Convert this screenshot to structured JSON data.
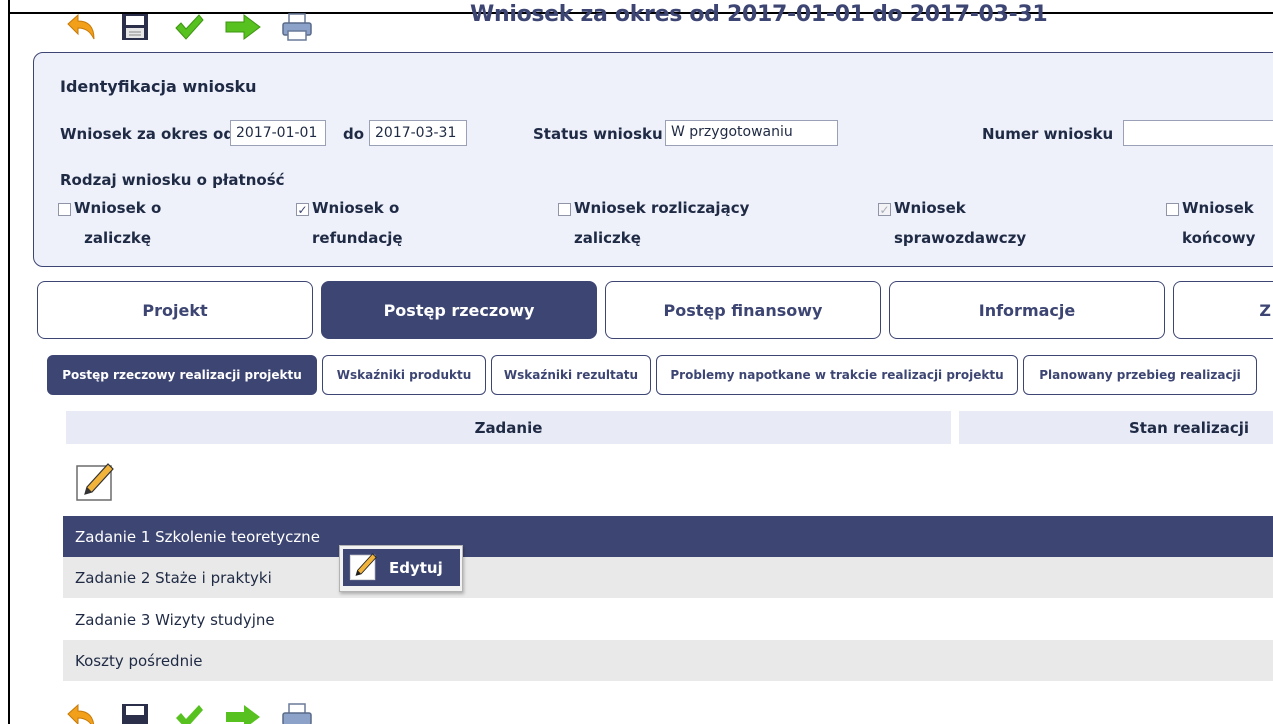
{
  "page_title": "Wniosek za okres od 2017-01-01 do 2017-03-31",
  "toolbar": {
    "icons": [
      "undo-icon",
      "save-icon",
      "check-icon",
      "send-icon",
      "print-icon"
    ]
  },
  "identification": {
    "title": "Identyfikacja wniosku",
    "period_from_label": "Wniosek za okres od",
    "period_from_value": "2017-01-01",
    "period_to_label": "do",
    "period_to_value": "2017-03-31",
    "status_label": "Status wniosku",
    "status_value": "W przygotowaniu",
    "number_label": "Numer wniosku",
    "number_value": "",
    "type_label": "Rodzaj wniosku o płatność",
    "types": [
      {
        "line1": "Wniosek o",
        "line2": "zaliczkę",
        "checked": false,
        "disabled": false
      },
      {
        "line1": "Wniosek o",
        "line2": "refundację",
        "checked": true,
        "disabled": false
      },
      {
        "line1": "Wniosek rozliczający",
        "line2": "zaliczkę",
        "checked": false,
        "disabled": false
      },
      {
        "line1": "Wniosek",
        "line2": "sprawozdawczy",
        "checked": true,
        "disabled": true
      },
      {
        "line1": "Wniosek",
        "line2": "końcowy",
        "checked": false,
        "disabled": false
      }
    ]
  },
  "tabs": [
    {
      "label": "Projekt",
      "active": false
    },
    {
      "label": "Postęp rzeczowy",
      "active": true
    },
    {
      "label": "Postęp finansowy",
      "active": false
    },
    {
      "label": "Informacje",
      "active": false
    },
    {
      "label": "Z",
      "active": false
    }
  ],
  "subtabs": [
    {
      "label": "Postęp rzeczowy realizacji projektu",
      "active": true
    },
    {
      "label": "Wskaźniki produktu",
      "active": false
    },
    {
      "label": "Wskaźniki rezultatu",
      "active": false
    },
    {
      "label": "Problemy napotkane w trakcie realizacji projektu",
      "active": false
    },
    {
      "label": "Planowany przebieg realizacji",
      "active": false
    }
  ],
  "table": {
    "headers": [
      "Zadanie",
      "Stan realizacji"
    ],
    "rows": [
      {
        "label": "Zadanie 1 Szkolenie teoretyczne",
        "selected": true
      },
      {
        "label": "Zadanie 2 Staże i praktyki",
        "selected": false
      },
      {
        "label": "Zadanie 3 Wizyty studyjne",
        "selected": false
      },
      {
        "label": "Koszty pośrednie",
        "selected": false
      }
    ]
  },
  "context_menu": {
    "edit_label": "Edytuj",
    "icon": "pencil-icon"
  },
  "colors": {
    "accent": "#3d4573",
    "panel_bg": "#eef0fa",
    "header_bg": "#e8eaf6",
    "row_alt": "#e9e9e9"
  }
}
